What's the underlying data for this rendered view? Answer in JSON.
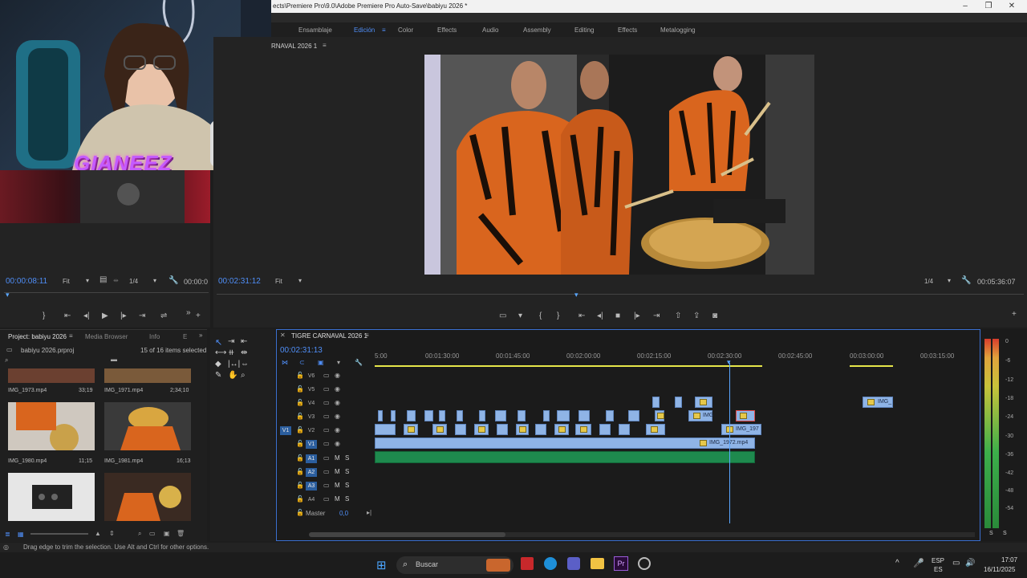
{
  "window": {
    "title": "ects\\Premiere Pro\\9.0\\Adobe Premiere Pro Auto-Save\\babiyu 2026 *"
  },
  "workspaces": [
    {
      "label": "Ensamblaje"
    },
    {
      "label": "Edición"
    },
    {
      "label": "Color"
    },
    {
      "label": "Effects"
    },
    {
      "label": "Audio"
    },
    {
      "label": "Assembly"
    },
    {
      "label": "Editing"
    },
    {
      "label": "Effects"
    },
    {
      "label": "Metalogging"
    }
  ],
  "webcam": {
    "streamer_name": "GIANEEZ"
  },
  "program": {
    "tab_label": "RNAVAL 2026 1",
    "timecode_left": "00:02:31:12",
    "fit_label": "Fit",
    "quality_label": "1/4",
    "duration": "00:05:36:07"
  },
  "source": {
    "timecode": "00:00:08:11",
    "fit_label": "Fit",
    "quality_label": "1/4",
    "duration_partial": "00:00:0"
  },
  "project": {
    "tab_label": "Project: babiyu 2026",
    "tab_media_browser": "Media Browser",
    "tab_info": "Info",
    "tab_e": "E",
    "file_name": "babiyu 2026.prproj",
    "selection_count": "15 of 16 items selected",
    "items": [
      {
        "name": "IMG_1973.mp4",
        "duration": "33;19"
      },
      {
        "name": "IMG_1971.mp4",
        "duration": "2;34;10"
      },
      {
        "name": "IMG_1980.mp4",
        "duration": "11;15"
      },
      {
        "name": "IMG_1981.mp4",
        "duration": "16;13"
      },
      {
        "name": "",
        "duration": ""
      },
      {
        "name": "",
        "duration": ""
      }
    ]
  },
  "timeline": {
    "tab_label": "TIGRE CARNAVAL 2026 1",
    "timecode": "00:02:31:13",
    "ruler": [
      "5:00",
      "00:01:30:00",
      "00:01:45:00",
      "00:02:00:00",
      "00:02:15:00",
      "00:02:30:00",
      "00:02:45:00",
      "00:03:00:00",
      "00:03:15:00"
    ],
    "tracks": [
      {
        "label": "V6"
      },
      {
        "label": "V5"
      },
      {
        "label": "V4"
      },
      {
        "label": "V3"
      },
      {
        "label": "V2"
      },
      {
        "label": "V1"
      },
      {
        "label": "A1"
      },
      {
        "label": "A2"
      },
      {
        "label": "A3"
      },
      {
        "label": "A4"
      }
    ],
    "source_patch": "V1",
    "master_label": "Master",
    "master_value": "0,0",
    "mute_label": "M",
    "solo_label": "S",
    "clip_names": {
      "v1_main": "IMG_1972.mp4",
      "v2_tail": "IMG_197",
      "v3_tail": "IMG",
      "v4_far": "IMG_"
    }
  },
  "meter": {
    "scale": [
      "0",
      "-6",
      "-12",
      "-18",
      "-24",
      "-30",
      "-36",
      "-42",
      "-48",
      "-54"
    ],
    "solo_left": "S",
    "solo_right": "S"
  },
  "status": {
    "message": "Drag edge to trim the selection. Use Alt and Ctrl for other options."
  },
  "taskbar": {
    "search_placeholder": "Buscar",
    "lang_top": "ESP",
    "lang_bottom": "ES",
    "time": "17:07",
    "date": "16/11/2025"
  },
  "colors": {
    "accent": "#4f8ef7",
    "clip_video": "#8fb4e6",
    "clip_audio": "#1e8a4e",
    "playhead": "#5aa7ff",
    "work_area": "#e6e64a"
  }
}
